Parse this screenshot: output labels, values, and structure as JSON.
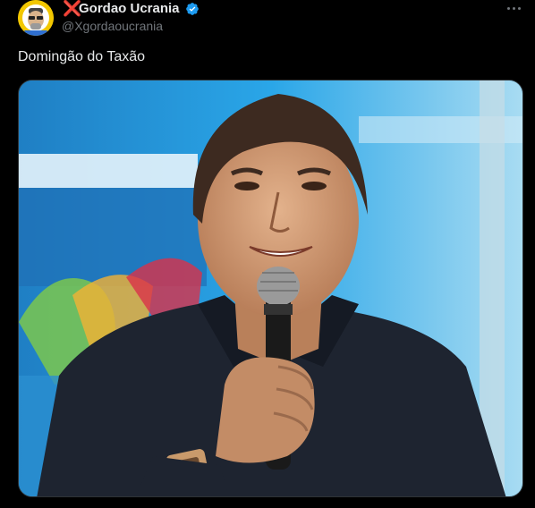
{
  "author": {
    "display_name": "Gordao Ucrania",
    "handle": "@Xgordaoucrania",
    "name_prefix_symbol": "❌",
    "verified": true,
    "verified_icon": "verified-badge-icon",
    "avatar_icon": "avatar-cartoon-icon"
  },
  "tweet": {
    "text": "Domingão do Taxão",
    "more_icon": "more-dots-icon",
    "media_description_icon": "tweet-photo"
  },
  "colors": {
    "background": "#000000",
    "text_primary": "#e7e9ea",
    "text_secondary": "#71767b",
    "verified_blue": "#1d9bf0",
    "x_red": "#e0245e"
  }
}
